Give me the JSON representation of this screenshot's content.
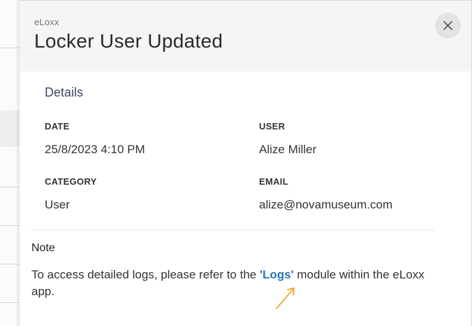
{
  "header": {
    "app_name": "eLoxx",
    "title": "Locker User Updated",
    "close_icon": "close-icon"
  },
  "details": {
    "section_title": "Details",
    "date_label": "DATE",
    "date_value": "25/8/2023 4:10 PM",
    "user_label": "USER",
    "user_value": "Alize Miller",
    "category_label": "CATEGORY",
    "category_value": "User",
    "email_label": "EMAIL",
    "email_value": "alize@novamuseum.com"
  },
  "note": {
    "title": "Note",
    "text_before": "To access detailed logs, please refer to the ",
    "link_text": "'Logs'",
    "text_after": " module within the eLoxx app."
  },
  "colors": {
    "link": "#2f76b6",
    "section_title": "#3a4a66",
    "header_bg": "#f5f5f5",
    "arrow": "#f2a93b"
  }
}
